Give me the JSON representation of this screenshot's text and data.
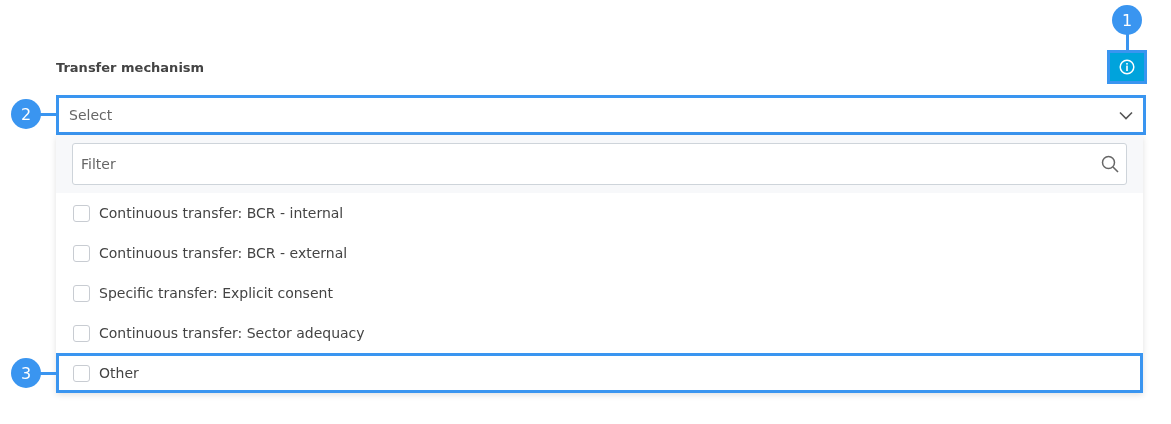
{
  "field": {
    "label": "Transfer mechanism",
    "info_button": {
      "callout": "1"
    },
    "select": {
      "placeholder": "Select",
      "expanded": true,
      "callout": "2"
    },
    "dropdown": {
      "filter": {
        "placeholder": "Filter"
      },
      "options": [
        {
          "label": "Continuous transfer: BCR - internal",
          "checked": false
        },
        {
          "label": "Continuous transfer: BCR - external",
          "checked": false
        },
        {
          "label": "Specific transfer: Explicit consent",
          "checked": false
        },
        {
          "label": "Continuous transfer: Sector adequacy",
          "checked": false
        },
        {
          "label": "Other",
          "checked": false,
          "callout": "3"
        }
      ]
    }
  }
}
